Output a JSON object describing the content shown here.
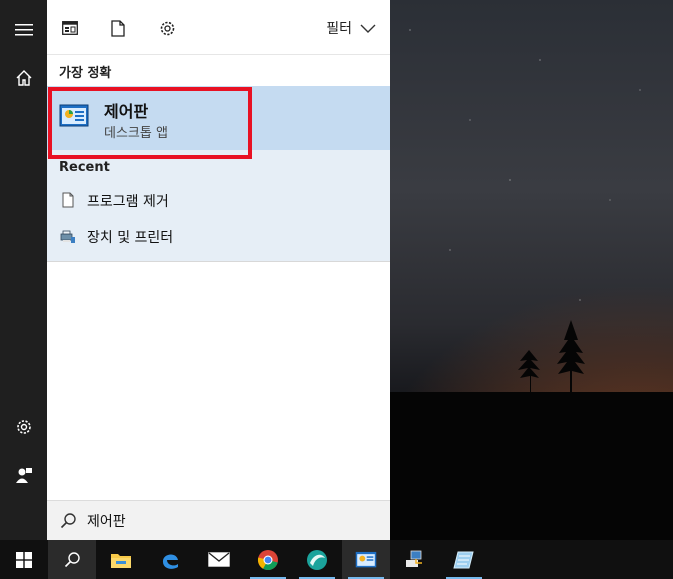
{
  "filter": {
    "label": "필터"
  },
  "best_match": {
    "header": "가장 정확",
    "title": "제어판",
    "subtitle": "데스크톱 앱"
  },
  "recent": {
    "header": "Recent",
    "items": [
      {
        "label": "프로그램 제거",
        "icon": "document-icon"
      },
      {
        "label": "장치 및 프린터",
        "icon": "devices-printers-icon"
      }
    ]
  },
  "search": {
    "value": "제어판"
  },
  "colors": {
    "accent": "#0078d7",
    "highlight": "#c5dbf1",
    "selection_box": "#e81123"
  }
}
